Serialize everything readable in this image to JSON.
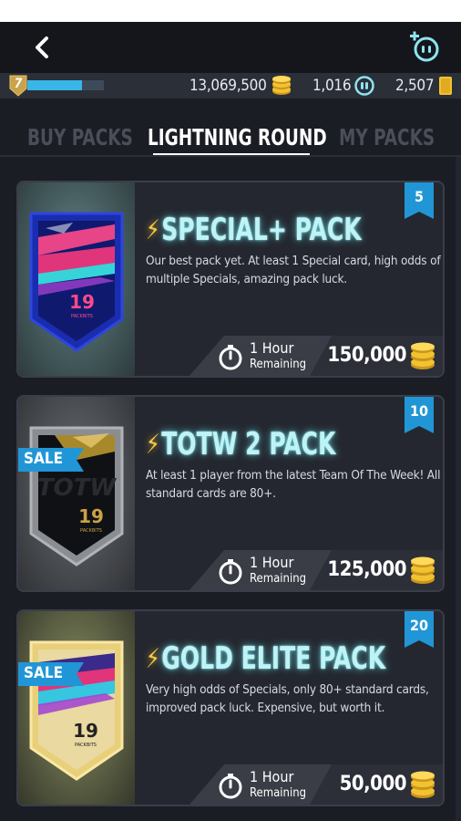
{
  "header": {
    "back_icon": "chevron-left-icon",
    "friends_icon": "add-friend-icon"
  },
  "resources": {
    "level": "7",
    "xp_progress": 0.72,
    "coins": "13,069,500",
    "tokens": "1,016",
    "points": "2,507"
  },
  "tabs": [
    {
      "label": "BUY PACKS",
      "active": false
    },
    {
      "label": "LIGHTNING ROUND",
      "active": true
    },
    {
      "label": "MY PACKS",
      "active": false
    }
  ],
  "packs": [
    {
      "title": "SPECIAL+ PACK",
      "description": "Our best pack yet. At least 1 Special card, high odds of multiple Specials, amazing pack luck.",
      "badge": "5",
      "sale": "",
      "timer_top": "1 Hour",
      "timer_bottom": "Remaining",
      "price": "150,000",
      "card_number": "19",
      "card_brand": "PACKBITS",
      "card_watermark": ""
    },
    {
      "title": "TOTW 2 PACK",
      "description": "At least 1 player from the latest Team Of The Week! All standard cards are 80+.",
      "badge": "10",
      "sale": "SALE",
      "timer_top": "1 Hour",
      "timer_bottom": "Remaining",
      "price": "125,000",
      "card_number": "19",
      "card_brand": "PACKBITS",
      "card_watermark": "TOTW"
    },
    {
      "title": "GOLD ELITE PACK",
      "description": "Very high odds of Specials, only 80+ standard cards, improved pack luck. Expensive, but worth it.",
      "badge": "20",
      "sale": "SALE",
      "timer_top": "1 Hour",
      "timer_bottom": "Remaining",
      "price": "50,000",
      "card_number": "19",
      "card_brand": "PACKBITS",
      "card_watermark": ""
    }
  ],
  "colors": {
    "accent_blue": "#2196d6",
    "title_glow": "#bff3f6",
    "bolt": "#f4c842",
    "coin_gold": "#f2c230"
  }
}
